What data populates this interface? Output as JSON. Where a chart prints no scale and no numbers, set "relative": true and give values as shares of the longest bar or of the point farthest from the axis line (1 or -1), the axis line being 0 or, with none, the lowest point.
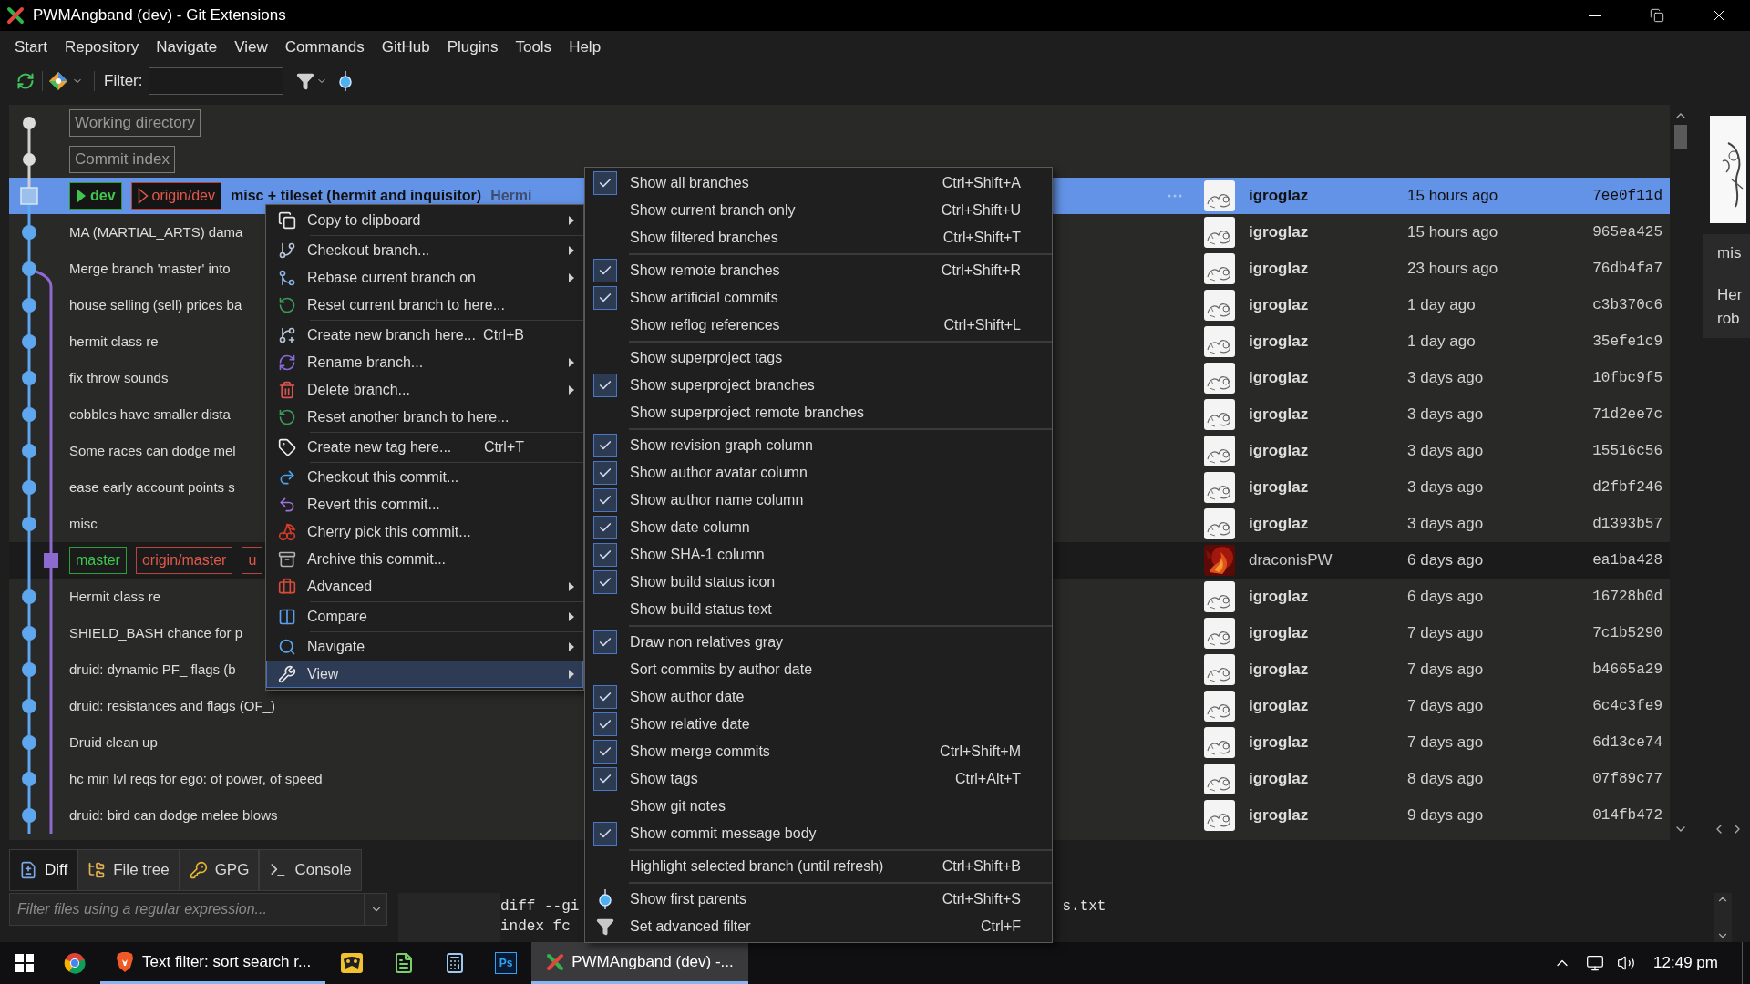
{
  "window": {
    "title": "PWMAngband (dev) - Git Extensions"
  },
  "menu_bar": [
    "Start",
    "Repository",
    "Navigate",
    "View",
    "Commands",
    "GitHub",
    "Plugins",
    "Tools",
    "Help"
  ],
  "toolbar": {
    "filter_label": "Filter:"
  },
  "revisions": [
    {
      "kind": "artificial",
      "graph_node": {
        "kind": "artificial"
      },
      "message": "Working directory",
      "selected": false,
      "highlighted": false
    },
    {
      "kind": "artificial",
      "graph_node": {
        "kind": "artificial"
      },
      "message": "Commit index",
      "selected": false,
      "highlighted": false
    },
    {
      "kind": "commit",
      "graph_node": {
        "kind": "current"
      },
      "refs": [
        {
          "name": "dev",
          "kind": "local",
          "marker": {
            "kind": "filled"
          }
        },
        {
          "name": "origin/dev",
          "kind": "remote",
          "marker": {
            "kind": "outline"
          }
        }
      ],
      "message": "misc + tileset (hermit and inquisitor)",
      "body": "Hermi",
      "author": "igroglaz",
      "relative": true,
      "avatar": {
        "kind": "default"
      },
      "date": "15 hours ago",
      "sha": "7ee0f11d",
      "selected": true,
      "highlighted": false
    },
    {
      "kind": "commit",
      "graph_node": {
        "kind": "commit"
      },
      "message": "MA (MARTIAL_ARTS) dama",
      "author": "igroglaz",
      "relative": true,
      "avatar": {
        "kind": "default"
      },
      "date": "15 hours ago",
      "sha": "965ea425",
      "selected": false,
      "highlighted": false
    },
    {
      "kind": "commit",
      "graph_node": {
        "kind": "commit"
      },
      "side_line": {
        "kind": "fork"
      },
      "message": "Merge branch 'master' into",
      "author": "igroglaz",
      "relative": true,
      "avatar": {
        "kind": "default"
      },
      "date": "23 hours ago",
      "sha": "76db4fa7",
      "selected": false,
      "highlighted": false
    },
    {
      "kind": "commit",
      "graph_node": {
        "kind": "commit"
      },
      "side_line": {
        "kind": "through"
      },
      "message": "house selling (sell) prices ba",
      "author": "igroglaz",
      "relative": true,
      "avatar": {
        "kind": "default"
      },
      "date": "1 day ago",
      "sha": "c3b370c6",
      "selected": false,
      "highlighted": false
    },
    {
      "kind": "commit",
      "graph_node": {
        "kind": "commit"
      },
      "side_line": {
        "kind": "through"
      },
      "message": "hermit class re",
      "author": "igroglaz",
      "relative": true,
      "avatar": {
        "kind": "default"
      },
      "date": "1 day ago",
      "sha": "35efe1c9",
      "selected": false,
      "highlighted": false
    },
    {
      "kind": "commit",
      "graph_node": {
        "kind": "commit"
      },
      "side_line": {
        "kind": "through"
      },
      "message": "fix throw sounds",
      "author": "igroglaz",
      "relative": true,
      "avatar": {
        "kind": "default"
      },
      "date": "3 days ago",
      "sha": "10fbc9f5",
      "selected": false,
      "highlighted": false
    },
    {
      "kind": "commit",
      "graph_node": {
        "kind": "commit"
      },
      "side_line": {
        "kind": "through"
      },
      "message": "cobbles have smaller dista",
      "author": "igroglaz",
      "relative": true,
      "avatar": {
        "kind": "default"
      },
      "date": "3 days ago",
      "sha": "71d2ee7c",
      "selected": false,
      "highlighted": false
    },
    {
      "kind": "commit",
      "graph_node": {
        "kind": "commit"
      },
      "side_line": {
        "kind": "through"
      },
      "message": "Some races can dodge mel",
      "author": "igroglaz",
      "relative": true,
      "avatar": {
        "kind": "default"
      },
      "date": "3 days ago",
      "sha": "15516c56",
      "selected": false,
      "highlighted": false
    },
    {
      "kind": "commit",
      "graph_node": {
        "kind": "commit"
      },
      "side_line": {
        "kind": "through"
      },
      "message": "ease early account points s",
      "author": "igroglaz",
      "relative": true,
      "avatar": {
        "kind": "default"
      },
      "date": "3 days ago",
      "sha": "d2fbf246",
      "selected": false,
      "highlighted": false
    },
    {
      "kind": "commit",
      "graph_node": {
        "kind": "commit"
      },
      "side_line": {
        "kind": "through"
      },
      "message": "misc",
      "author": "igroglaz",
      "relative": true,
      "avatar": {
        "kind": "default"
      },
      "date": "3 days ago",
      "sha": "d1393b57",
      "selected": false,
      "highlighted": false
    },
    {
      "kind": "commit",
      "graph_node": {
        "kind": "side"
      },
      "side_line": {
        "kind": "through"
      },
      "refs": [
        {
          "name": "master",
          "kind": "local"
        },
        {
          "name": "origin/master",
          "kind": "remote"
        },
        {
          "name": "u",
          "kind": "remote"
        }
      ],
      "author": "draconisPW",
      "relative": false,
      "avatar": {
        "kind": "picture"
      },
      "date": "6 days ago",
      "sha": "ea1ba428",
      "selected": false,
      "highlighted": true
    },
    {
      "kind": "commit",
      "graph_node": {
        "kind": "commit"
      },
      "side_line": {
        "kind": "through"
      },
      "message": "Hermit class re",
      "author": "igroglaz",
      "relative": true,
      "avatar": {
        "kind": "default"
      },
      "date": "6 days ago",
      "sha": "16728b0d",
      "selected": false,
      "highlighted": false
    },
    {
      "kind": "commit",
      "graph_node": {
        "kind": "commit"
      },
      "side_line": {
        "kind": "through"
      },
      "message": "SHIELD_BASH chance for p",
      "author": "igroglaz",
      "relative": true,
      "avatar": {
        "kind": "default"
      },
      "date": "7 days ago",
      "sha": "7c1b5290",
      "selected": false,
      "highlighted": false
    },
    {
      "kind": "commit",
      "graph_node": {
        "kind": "commit"
      },
      "side_line": {
        "kind": "through"
      },
      "message": "druid: dynamic PF_ flags (b",
      "author": "igroglaz",
      "relative": true,
      "avatar": {
        "kind": "default"
      },
      "date": "7 days ago",
      "sha": "b4665a29",
      "selected": false,
      "highlighted": false
    },
    {
      "kind": "commit",
      "graph_node": {
        "kind": "commit"
      },
      "side_line": {
        "kind": "through"
      },
      "message": "druid: resistances and flags (OF_)",
      "author": "igroglaz",
      "relative": true,
      "avatar": {
        "kind": "default"
      },
      "date": "7 days ago",
      "sha": "6c4c3fe9",
      "selected": false,
      "highlighted": false
    },
    {
      "kind": "commit",
      "graph_node": {
        "kind": "commit"
      },
      "side_line": {
        "kind": "through"
      },
      "message": "Druid clean up",
      "author": "igroglaz",
      "relative": true,
      "avatar": {
        "kind": "default"
      },
      "date": "7 days ago",
      "sha": "6d13ce74",
      "selected": false,
      "highlighted": false
    },
    {
      "kind": "commit",
      "graph_node": {
        "kind": "commit"
      },
      "side_line": {
        "kind": "through"
      },
      "message": "hc min lvl reqs for ego: of power, of speed",
      "author": "igroglaz",
      "relative": true,
      "avatar": {
        "kind": "default"
      },
      "date": "8 days ago",
      "sha": "07f89c77",
      "selected": false,
      "highlighted": false
    },
    {
      "kind": "commit",
      "graph_node": {
        "kind": "commit"
      },
      "side_line": {
        "kind": "through"
      },
      "message": "druid: bird can dodge melee blows",
      "author": "igroglaz",
      "relative": true,
      "avatar": {
        "kind": "default"
      },
      "date": "9 days ago",
      "sha": "014fb472",
      "selected": false,
      "highlighted": false
    }
  ],
  "commit_info": {
    "lines": [
      "mis",
      "Her",
      "rob"
    ]
  },
  "context_menu": {
    "groups": [
      {
        "items": [
          {
            "label": "Copy to clipboard",
            "submenu": true,
            "selected": false
          }
        ]
      },
      {
        "items": [
          {
            "label": "Checkout branch...",
            "submenu": true,
            "selected": false
          },
          {
            "label": "Rebase current branch on",
            "submenu": true,
            "selected": false
          },
          {
            "label": "Reset current branch to here...",
            "submenu": false,
            "selected": false
          }
        ]
      },
      {
        "items": [
          {
            "label": "Create new branch here...",
            "shortcut": "Ctrl+B",
            "submenu": false,
            "selected": false
          },
          {
            "label": "Rename branch...",
            "submenu": true,
            "selected": false
          },
          {
            "label": "Delete branch...",
            "submenu": true,
            "selected": false
          },
          {
            "label": "Reset another branch to here...",
            "submenu": false,
            "selected": false
          }
        ]
      },
      {
        "items": [
          {
            "label": "Create new tag here...",
            "shortcut": "Ctrl+T",
            "submenu": false,
            "selected": false
          }
        ]
      },
      {
        "items": [
          {
            "label": "Checkout this commit...",
            "submenu": false,
            "selected": false
          },
          {
            "label": "Revert this commit...",
            "submenu": false,
            "selected": false
          },
          {
            "label": "Cherry pick this commit...",
            "submenu": false,
            "selected": false
          },
          {
            "label": "Archive this commit...",
            "submenu": false,
            "selected": false
          },
          {
            "label": "Advanced",
            "submenu": true,
            "selected": false
          }
        ]
      },
      {
        "items": [
          {
            "label": "Compare",
            "submenu": true,
            "selected": false
          }
        ]
      },
      {
        "items": [
          {
            "label": "Navigate",
            "submenu": true,
            "selected": false
          },
          {
            "label": "View",
            "submenu": true,
            "selected": true
          }
        ]
      }
    ]
  },
  "view_menu": {
    "groups": [
      {
        "items": [
          {
            "kind": "check",
            "label": "Show all branches",
            "shortcut": "Ctrl+Shift+A",
            "checked": true
          },
          {
            "kind": "check",
            "label": "Show current branch only",
            "shortcut": "Ctrl+Shift+U",
            "checked": false
          },
          {
            "kind": "check",
            "label": "Show filtered branches",
            "shortcut": "Ctrl+Shift+T",
            "checked": false
          }
        ]
      },
      {
        "items": [
          {
            "kind": "check",
            "label": "Show remote branches",
            "shortcut": "Ctrl+Shift+R",
            "checked": true
          },
          {
            "kind": "check",
            "label": "Show artificial commits",
            "checked": true
          },
          {
            "kind": "check",
            "label": "Show reflog references",
            "shortcut": "Ctrl+Shift+L",
            "checked": false
          }
        ]
      },
      {
        "items": [
          {
            "kind": "check",
            "label": "Show superproject tags",
            "checked": false
          },
          {
            "kind": "check",
            "label": "Show superproject branches",
            "checked": true
          },
          {
            "kind": "check",
            "label": "Show superproject remote branches",
            "checked": false
          }
        ]
      },
      {
        "items": [
          {
            "kind": "check",
            "label": "Show revision graph column",
            "checked": true
          },
          {
            "kind": "check",
            "label": "Show author avatar column",
            "checked": true
          },
          {
            "kind": "check",
            "label": "Show author name column",
            "checked": true
          },
          {
            "kind": "check",
            "label": "Show date column",
            "checked": true
          },
          {
            "kind": "check",
            "label": "Show SHA-1 column",
            "checked": true
          },
          {
            "kind": "check",
            "label": "Show build status icon",
            "checked": true
          },
          {
            "kind": "check",
            "label": "Show build status text",
            "checked": false
          }
        ]
      },
      {
        "items": [
          {
            "kind": "check",
            "label": "Draw non relatives gray",
            "checked": true
          },
          {
            "kind": "check",
            "label": "Sort commits by author date",
            "checked": false
          },
          {
            "kind": "check",
            "label": "Show author date",
            "checked": true
          },
          {
            "kind": "check",
            "label": "Show relative date",
            "checked": true
          },
          {
            "kind": "check",
            "label": "Show merge commits",
            "shortcut": "Ctrl+Shift+M",
            "checked": true
          },
          {
            "kind": "check",
            "label": "Show tags",
            "shortcut": "Ctrl+Alt+T",
            "checked": true
          },
          {
            "kind": "check",
            "label": "Show git notes",
            "checked": false
          },
          {
            "kind": "check",
            "label": "Show commit message body",
            "checked": true
          }
        ]
      },
      {
        "items": [
          {
            "kind": "plain",
            "label": "Highlight selected branch (until refresh)",
            "shortcut": "Ctrl+Shift+B"
          }
        ]
      },
      {
        "items": [
          {
            "kind": "icon",
            "label": "Show first parents",
            "shortcut": "Ctrl+Shift+S"
          },
          {
            "kind": "icon",
            "label": "Set advanced filter",
            "shortcut": "Ctrl+F"
          }
        ]
      }
    ]
  },
  "bottom_tabs": [
    {
      "label": "Diff",
      "selected": true
    },
    {
      "label": "File tree",
      "selected": false
    },
    {
      "label": "GPG",
      "selected": false
    },
    {
      "label": "Console",
      "selected": false
    }
  ],
  "file_filter": {
    "placeholder": "Filter files using a regular expression..."
  },
  "diff_lines": [
    {
      "left": "diff --gi",
      "right": "s.txt"
    },
    {
      "left": "index fc"
    }
  ],
  "taskbar": {
    "items": [
      {
        "kind": "chrome",
        "running": false,
        "active": false
      },
      {
        "kind": "brave",
        "label": "Text filter: sort search r...",
        "running": true,
        "active": false
      },
      {
        "kind": "app",
        "running": false,
        "active": false
      },
      {
        "kind": "notepad",
        "running": false,
        "active": false
      },
      {
        "kind": "calculator",
        "running": false,
        "active": false
      },
      {
        "kind": "photoshop",
        "text": "Ps",
        "running": false,
        "active": false
      },
      {
        "kind": "gitext",
        "label": "PWMAngband (dev) -...",
        "running": true,
        "active": true
      }
    ],
    "clock": "12:49 pm"
  }
}
